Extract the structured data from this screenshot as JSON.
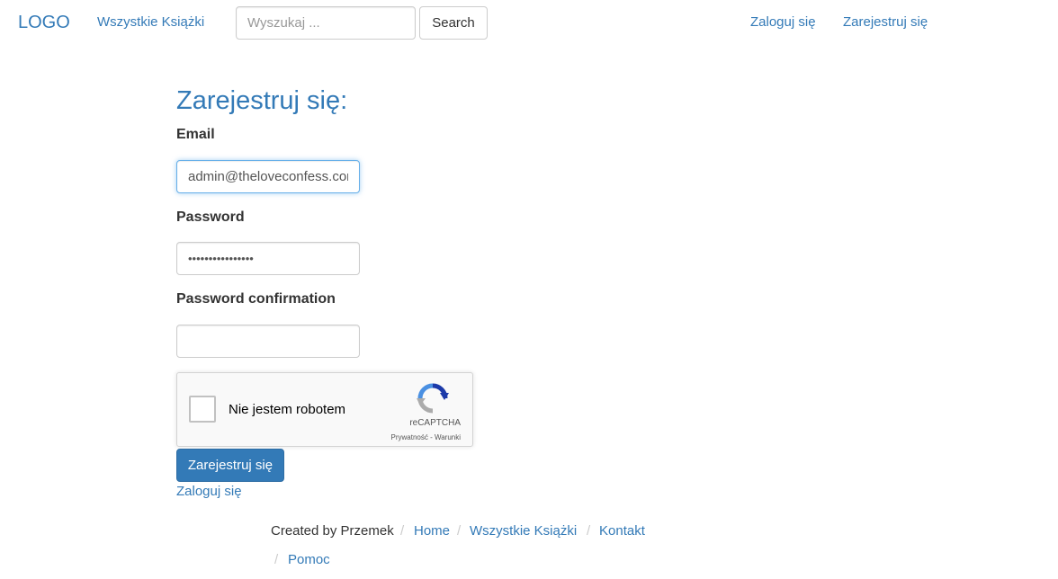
{
  "navbar": {
    "logo": "LOGO",
    "all_books": "Wszystkie Książki",
    "search_placeholder": "Wyszukaj ...",
    "search_button": "Search",
    "login": "Zaloguj się",
    "register": "Zarejestruj się"
  },
  "form": {
    "title": "Zarejestruj się:",
    "email_label": "Email",
    "email_value": "admin@theloveconfess.com",
    "password_label": "Password",
    "password_mask": "••••••••••••••••",
    "confirmation_label": "Password confirmation",
    "confirmation_value": "",
    "submit_label": "Zarejestruj się",
    "login_link": "Zaloguj się"
  },
  "captcha": {
    "checkbox_label": "Nie jestem robotem",
    "brand": "reCAPTCHA",
    "terms": "Prywatność - Warunki",
    "icon": "recaptcha-logo"
  },
  "footer": {
    "created_by": "Created by Przemek",
    "separator": "/",
    "links": [
      "Home",
      "Wszystkie Książki",
      "Kontakt",
      "Pomoc"
    ]
  },
  "colors": {
    "link": "#337ab7",
    "primary_button": "#337ab7",
    "focus_border": "#66afe9"
  }
}
